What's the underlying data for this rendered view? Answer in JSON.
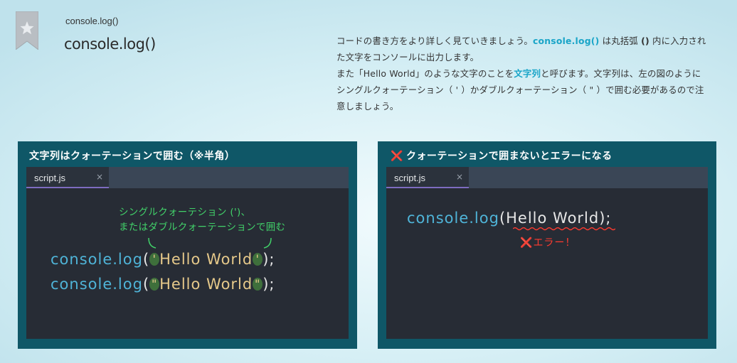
{
  "header": {
    "subtitle": "console.log()",
    "title": "console.log()"
  },
  "description": {
    "p1_a": "コードの書き方をより詳しく見ていきましょう。",
    "p1_hl": "console.log()",
    "p1_b": " は丸括弧 ",
    "p1_bold": "()",
    "p1_c": " 内に入力された文字をコンソールに出力します。",
    "p2_a": "また「Hello World」のような文字のことを",
    "p2_hl": "文字列",
    "p2_b": "と呼びます。文字列は、左の図のようにシングルクォーテーション（ ' ）かダブルクォーテーション（ \" ）で囲む必要があるので注意しましょう。"
  },
  "left_panel": {
    "title": "文字列はクォーテーションで囲む（※半角）",
    "tab": {
      "label": "script.js",
      "close": "×"
    },
    "annotation": [
      "シングルクォーテション (')、",
      "またはダブルクォーテーションで囲む"
    ],
    "code_lines": [
      {
        "fn": "console.log",
        "open": "(",
        "q": "'",
        "str": "Hello World",
        "close": ");"
      },
      {
        "fn": "console.log",
        "open": "(",
        "q": "\"",
        "str": "Hello World",
        "close": ");"
      }
    ]
  },
  "right_panel": {
    "mark": "❌",
    "title": "クォーテーションで囲まないとエラーになる",
    "tab": {
      "label": "script.js",
      "close": "×"
    },
    "code": {
      "fn": "console.log",
      "open": "(",
      "arg": "Hello World",
      "close": ");"
    },
    "error_mark": "❌",
    "error_text": "エラー！"
  },
  "colors": {
    "accent": "#1aa5c8",
    "panel_bg": "#0f5767",
    "editor_bg": "#272c35",
    "code_fn": "#4fb4d8",
    "code_string": "#e6c98a",
    "annotation": "#41d169",
    "error": "#ff3b30"
  },
  "icons": {
    "bookmark": "star-bookmark-icon"
  }
}
